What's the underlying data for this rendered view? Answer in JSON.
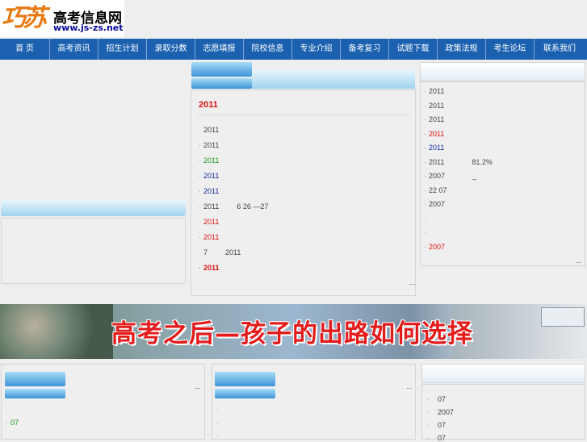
{
  "logo": {
    "glyph": "巧苏",
    "title": "高考信息网",
    "url": "www.js-zs.net"
  },
  "nav": {
    "items": [
      "首 页",
      "高考资讯",
      "招生计划",
      "录取分数",
      "志愿填报",
      "院校信息",
      "专业介绍",
      "备考复习",
      "试题下载",
      "政策法规",
      "考生论坛",
      "联系我们"
    ]
  },
  "center_panel": {
    "headline": "2011",
    "rows": [
      {
        "text": "2011",
        "color": "#444444"
      },
      {
        "text": "2011",
        "color": "#444444"
      },
      {
        "text": "2011",
        "color": "#1a9a1a"
      },
      {
        "text": "2011",
        "color": "#14289a"
      },
      {
        "text": "2011",
        "color": "#14289a"
      },
      {
        "text": "2011",
        "extra": "6 26 —27",
        "color": "#444444"
      },
      {
        "text": "2011",
        "color": "#dd1111"
      },
      {
        "text": "2011",
        "color": "#dd1111"
      },
      {
        "text": "7",
        "extra": "2011",
        "color": "#444444"
      },
      {
        "text": "2011",
        "color": "#dd1111",
        "bold": true
      }
    ],
    "more": "..."
  },
  "right_panel": {
    "rows": [
      {
        "text": "2011"
      },
      {
        "text": "2011"
      },
      {
        "text": "2011"
      },
      {
        "text": "2011",
        "color": "#dd1111"
      },
      {
        "text": "2011",
        "color": "#14289a"
      },
      {
        "text": "2011",
        "extra": "81.2%"
      },
      {
        "text": "2007",
        "extra": "_"
      },
      {
        "text": "22   07"
      },
      {
        "text": "2007"
      },
      {
        "text": ""
      },
      {
        "text": ""
      },
      {
        "text": "2007",
        "color": "#dd1111"
      }
    ],
    "more": "..."
  },
  "banner": {
    "title": "高考之后—孩子的出路如何选择"
  },
  "bottom_left": {
    "rows": [
      "",
      "07"
    ],
    "more": "..."
  },
  "bottom_middle": {
    "rows": [
      "",
      "",
      ""
    ],
    "more": "..."
  },
  "bottom_right": {
    "rows": [
      "07",
      "2007",
      "07",
      "07"
    ]
  }
}
